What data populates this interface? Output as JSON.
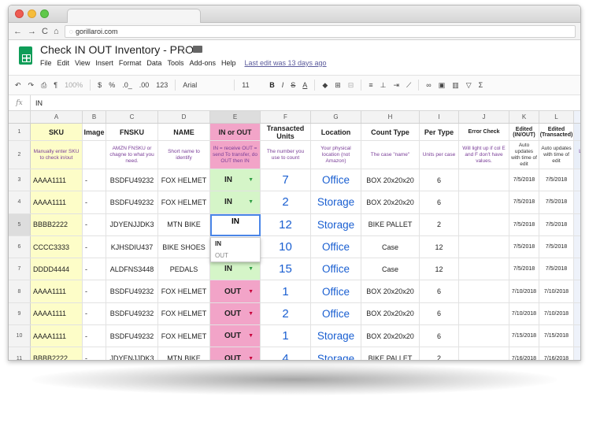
{
  "browser": {
    "url": "gorillaroi.com"
  },
  "doc": {
    "title": "Check IN OUT Inventory - PRO",
    "menus": [
      "File",
      "Edit",
      "View",
      "Insert",
      "Format",
      "Data",
      "Tools",
      "Add-ons",
      "Help"
    ],
    "last_edit": "Last edit was 13 days ago"
  },
  "toolbar": {
    "zoom": "100%",
    "currency": "$",
    "percent": "%",
    "dec_less": ".0_",
    "dec_more": ".00",
    "number_format": "123",
    "font": "Arial",
    "font_size": "11",
    "bold": "B",
    "italic": "I",
    "strike": "S",
    "text_color": "A",
    "sigma": "Σ"
  },
  "formula_bar": {
    "fx": "fx",
    "value": "IN"
  },
  "columns": [
    "A",
    "B",
    "C",
    "D",
    "E",
    "F",
    "G",
    "H",
    "I",
    "J",
    "K",
    "L"
  ],
  "headers": [
    "SKU",
    "Image",
    "FNSKU",
    "NAME",
    "IN or OUT",
    "Transacted Units",
    "Location",
    "Count Type",
    "Per Type",
    "Error Check",
    "Edited (IN/OUT)",
    "Edited (Transacted)"
  ],
  "subheaders": [
    "Manually enter SKU to check in/out",
    "",
    "AMZN FNSKU or chagne to what you need.",
    "Short name to identify",
    "IN = receive OUT = send To transfer, do OUT then IN",
    "The number you use to count",
    "Your physical location (not Amazon)",
    "The case \"name\"",
    "Units per case",
    "Will light up if col E and F don't have values.",
    "Auto updates with time of edit",
    "Auto updates with time of edit"
  ],
  "edge_text": {
    "header": "L",
    "sub": "Load you inve"
  },
  "rows": [
    {
      "num": "3",
      "sku": "AAAA1111",
      "image": "-",
      "fnsku": "BSDFU49232",
      "name": "FOX HELMET",
      "inout": "IN",
      "units": "7",
      "location": "Office",
      "count_type": "BOX 20x20x20",
      "per_type": "6",
      "edited1": "7/5/2018",
      "edited2": "7/5/2018"
    },
    {
      "num": "4",
      "sku": "AAAA1111",
      "image": "-",
      "fnsku": "BSDFU49232",
      "name": "FOX HELMET",
      "inout": "IN",
      "units": "2",
      "location": "Storage",
      "count_type": "BOX 20x20x20",
      "per_type": "6",
      "edited1": "7/5/2018",
      "edited2": "7/5/2018"
    },
    {
      "num": "5",
      "sku": "BBBB2222",
      "image": "-",
      "fnsku": "JDYENJJDK3",
      "name": "MTN BIKE",
      "inout": "IN",
      "units": "12",
      "location": "Storage",
      "count_type": "BIKE PALLET",
      "per_type": "2",
      "edited1": "7/5/2018",
      "edited2": "7/5/2018"
    },
    {
      "num": "6",
      "sku": "CCCC3333",
      "image": "-",
      "fnsku": "KJHSDIU437",
      "name": "BIKE SHOES",
      "inout": "",
      "units": "10",
      "location": "Office",
      "count_type": "Case",
      "per_type": "12",
      "edited1": "7/5/2018",
      "edited2": "7/5/2018"
    },
    {
      "num": "7",
      "sku": "DDDD4444",
      "image": "-",
      "fnsku": "ALDFNS3448",
      "name": "PEDALS",
      "inout": "IN",
      "units": "15",
      "location": "Office",
      "count_type": "Case",
      "per_type": "12",
      "edited1": "7/5/2018",
      "edited2": "7/5/2018"
    },
    {
      "num": "8",
      "sku": "AAAA1111",
      "image": "-",
      "fnsku": "BSDFU49232",
      "name": "FOX HELMET",
      "inout": "OUT",
      "units": "1",
      "location": "Office",
      "count_type": "BOX 20x20x20",
      "per_type": "6",
      "edited1": "7/10/2018",
      "edited2": "7/10/2018"
    },
    {
      "num": "9",
      "sku": "AAAA1111",
      "image": "-",
      "fnsku": "BSDFU49232",
      "name": "FOX HELMET",
      "inout": "OUT",
      "units": "2",
      "location": "Office",
      "count_type": "BOX 20x20x20",
      "per_type": "6",
      "edited1": "7/10/2018",
      "edited2": "7/10/2018"
    },
    {
      "num": "10",
      "sku": "AAAA1111",
      "image": "-",
      "fnsku": "BSDFU49232",
      "name": "FOX HELMET",
      "inout": "OUT",
      "units": "1",
      "location": "Storage",
      "count_type": "BOX 20x20x20",
      "per_type": "6",
      "edited1": "7/15/2018",
      "edited2": "7/15/2018"
    },
    {
      "num": "11",
      "sku": "BBBB2222",
      "image": "-",
      "fnsku": "JDYENJJDK3",
      "name": "MTN BIKE",
      "inout": "OUT",
      "units": "4",
      "location": "Storage",
      "count_type": "BIKE PALLET",
      "per_type": "2",
      "edited1": "7/16/2018",
      "edited2": "7/16/2018"
    }
  ],
  "dropdown": {
    "options": [
      "IN",
      "OUT"
    ]
  },
  "colors": {
    "sku_fill": "#fdfdc8",
    "out_fill": "#f2a4c8",
    "in_fill": "#d5f5c8",
    "value_blue": "#1a5fd1",
    "select_blue": "#4a86e8"
  }
}
